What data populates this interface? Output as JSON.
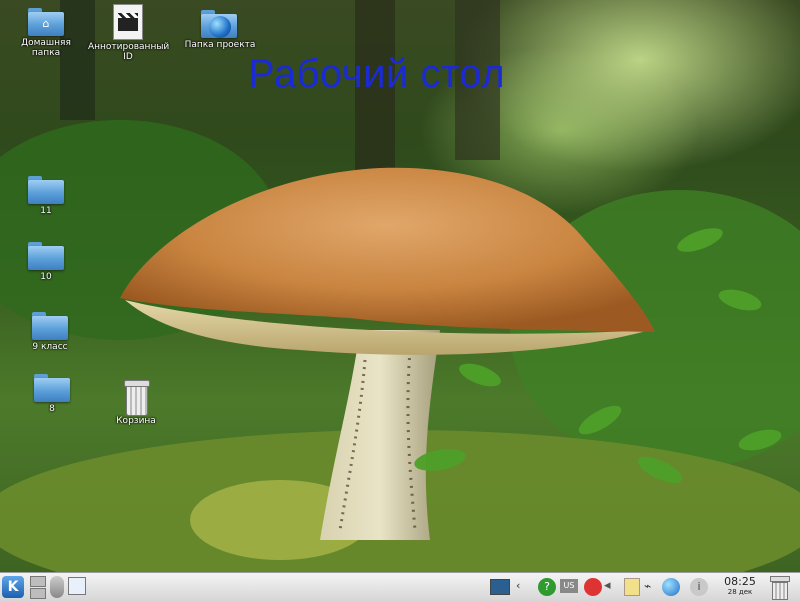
{
  "desktop": {
    "title": "Рабочий стол",
    "icons": [
      {
        "label": "Домашняя папка",
        "icon": "home-folder-icon"
      },
      {
        "label": "Аннотированный ID",
        "icon": "video-file-icon"
      },
      {
        "label": "Папка проекта",
        "icon": "network-folder-icon"
      },
      {
        "label": "11",
        "icon": "folder-icon"
      },
      {
        "label": "10",
        "icon": "folder-icon"
      },
      {
        "label": "9 класс",
        "icon": "folder-icon"
      },
      {
        "label": "8",
        "icon": "folder-icon"
      },
      {
        "label": "Корзина",
        "icon": "trash-icon"
      }
    ]
  },
  "taskbar": {
    "start_label": "K",
    "layout_indicator": "US",
    "clock_time": "08:25",
    "clock_date": "28 дек"
  },
  "colors": {
    "title": "#1a2bd6",
    "folder": "#5b9fd9",
    "taskbar": "#dcdcdc"
  }
}
